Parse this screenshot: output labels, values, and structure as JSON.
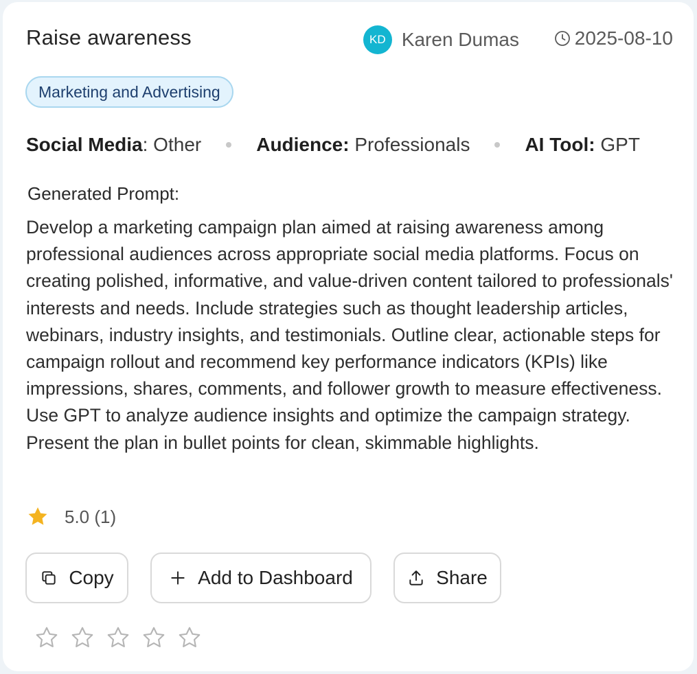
{
  "card": {
    "title": "Raise awareness",
    "author": {
      "initials": "KD",
      "name": "Karen Dumas",
      "avatar_color": "#13b5d1"
    },
    "date": "2025-08-10",
    "category": "Marketing and Advertising",
    "meta": {
      "social_media_label": "Social Media",
      "social_media_value": ": Other",
      "audience_label": "Audience:",
      "audience_value": " Professionals",
      "ai_tool_label": "AI Tool:",
      "ai_tool_value": " GPT"
    },
    "generated_prompt_label": "Generated Prompt:",
    "generated_prompt": "Develop a marketing campaign plan aimed at raising awareness among professional audiences across appropriate social media platforms. Focus on creating polished, informative, and value-driven content tailored to professionals' interests and needs. Include strategies such as thought leadership articles, webinars, industry insights, and testimonials. Outline clear, actionable steps for campaign rollout and recommend key performance indicators (KPIs) like impressions, shares, comments, and follower growth to measure effectiveness. Use GPT to analyze audience insights and optimize the campaign strategy. Present the plan in bullet points for clean, skimmable highlights.",
    "rating": {
      "text": "5.0 (1)",
      "star_color": "#f4b320"
    },
    "buttons": {
      "copy": "Copy",
      "add_to_dashboard": "Add to Dashboard",
      "share": "Share"
    },
    "user_rating": {
      "stars_total": 5,
      "stars_filled": 0
    }
  }
}
